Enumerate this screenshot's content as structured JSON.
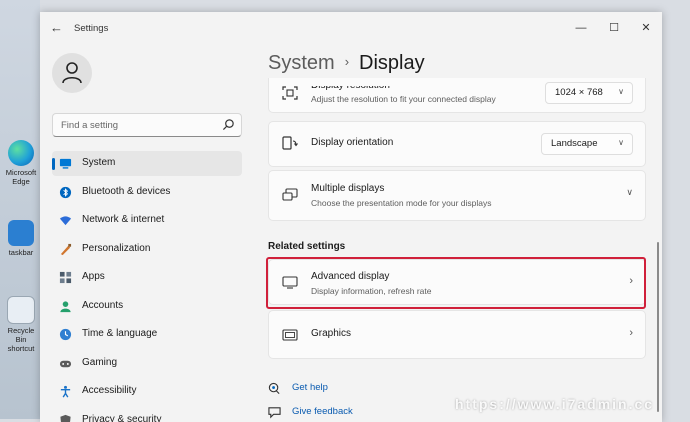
{
  "window": {
    "title": "Settings",
    "controls": {
      "minimize": "—",
      "maximize": "☐",
      "close": "✕"
    }
  },
  "desktop": {
    "icons": [
      {
        "label": "Microsoft Edge",
        "icon": "edge-icon"
      },
      {
        "label": "taskbar",
        "icon": "app-icon"
      },
      {
        "label": "Recycle Bin shortcut",
        "icon": "recycle-bin-icon"
      }
    ]
  },
  "search": {
    "placeholder": "Find a setting",
    "value": ""
  },
  "sidebar": {
    "items": [
      {
        "label": "System",
        "icon": "system-icon",
        "color": "#0078d4",
        "active": true
      },
      {
        "label": "Bluetooth & devices",
        "icon": "bluetooth-icon",
        "color": "#0067c0"
      },
      {
        "label": "Network & internet",
        "icon": "wifi-icon",
        "color": "#2b6cd8"
      },
      {
        "label": "Personalization",
        "icon": "brush-icon",
        "color": "#d1762e"
      },
      {
        "label": "Apps",
        "icon": "apps-icon",
        "color": "#4a5a6a"
      },
      {
        "label": "Accounts",
        "icon": "accounts-icon",
        "color": "#25a06c"
      },
      {
        "label": "Time & language",
        "icon": "time-icon",
        "color": "#2f7fd1"
      },
      {
        "label": "Gaming",
        "icon": "gaming-icon",
        "color": "#5a5a5a"
      },
      {
        "label": "Accessibility",
        "icon": "accessibility-icon",
        "color": "#1a73c9"
      },
      {
        "label": "Privacy & security",
        "icon": "shield-icon",
        "color": "#5a5a5a"
      }
    ]
  },
  "breadcrumb": {
    "parent": "System",
    "separator": "›",
    "current": "Display"
  },
  "cards": {
    "resolution": {
      "title": "Display resolution",
      "subtitle": "Adjust the resolution to fit your connected display",
      "value": "1024 × 768"
    },
    "orientation": {
      "title": "Display orientation",
      "value": "Landscape"
    },
    "multiple": {
      "title": "Multiple displays",
      "subtitle": "Choose the presentation mode for your displays"
    },
    "advanced": {
      "title": "Advanced display",
      "subtitle": "Display information, refresh rate"
    },
    "graphics": {
      "title": "Graphics"
    }
  },
  "related_settings_title": "Related settings",
  "help_links": [
    {
      "label": "Get help",
      "icon": "help-icon"
    },
    {
      "label": "Give feedback",
      "icon": "feedback-icon"
    }
  ],
  "watermark": "https://www.i7admin.cc",
  "colors": {
    "accent": "#0067c0",
    "highlight_border": "#d0203a"
  }
}
